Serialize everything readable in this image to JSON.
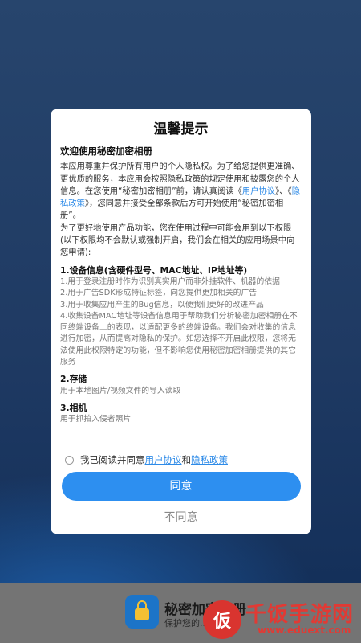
{
  "dialog": {
    "title": "温馨提示",
    "welcome": "欢迎使用秘密加密相册",
    "intro_p1_before": "本应用尊重并保护所有用户的个人隐私权。为了给您提供更准确、更优质的服务，本应用会按照隐私政策的规定使用和披露您的个人信息。在您使用“秘密加密相册”前，请认真阅读《",
    "user_agreement_inline": "用户协议",
    "intro_sep": "》、《",
    "privacy_inline": "隐私政策",
    "intro_p1_after": "》，您同意并接受全部条款后方可开始使用“秘密加密相册”。",
    "intro_p2": "为了更好地使用产品功能，您在使用过程中可能会用到以下权限(以下权限均不会默认或强制开启，我们会在相关的应用场景中向您申请):",
    "sections": [
      {
        "title": "1.设备信息(含硬件型号、MAC地址、IP地址等)",
        "items": [
          "1.用于登录注册时作为识别真实用户而非外挂软件、机器的依据",
          "2.用于广告SDK形成特征标签，向您提供更加相关的广告",
          "3.用于收集应用产生的Bug信息，以便我们更好的改进产品",
          "4.收集设备MAC地址等设备信息用于帮助我们分析秘密加密相册在不同终端设备上的表现，以适配更多的终端设备。我们会对收集的信息进行加密，从而提高对隐私的保护。如您选择不开启此权限，您将无法使用此权限特定的功能，但不影响您使用秘密加密相册提供的其它服务"
        ]
      },
      {
        "title": "2.存储",
        "items": [
          "用于本地图片/视频文件的导入读取"
        ]
      },
      {
        "title": "3.相机",
        "items": [
          "用于抓拍入侵者照片"
        ]
      }
    ],
    "agree_prefix": "我已阅读并同意",
    "agree_user_agreement": "用户协议",
    "agree_and": "和",
    "agree_privacy": "隐私政策",
    "agree_button": "同意",
    "disagree_button": "不同意"
  },
  "app_banner": {
    "name": "秘密加密相册",
    "subtitle": "保护您的..."
  },
  "watermark": {
    "icon_char": "仮",
    "text": "千饭手游网",
    "url": "www.eduext.com"
  },
  "colors": {
    "accent": "#2d8ff0",
    "link": "#2e8be8",
    "watermark": "#e13a34"
  }
}
